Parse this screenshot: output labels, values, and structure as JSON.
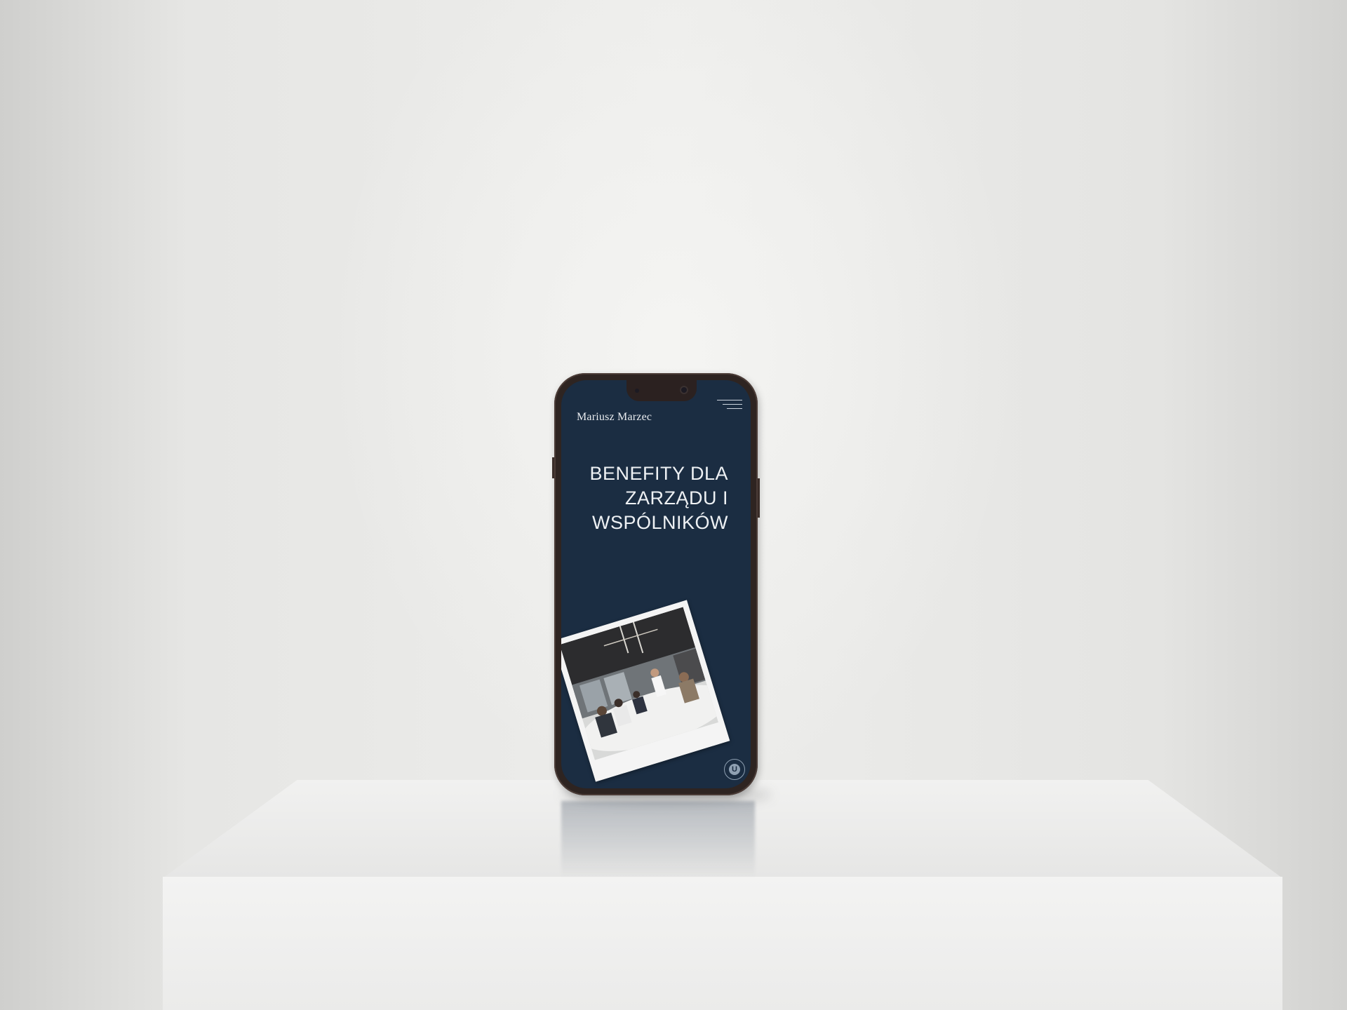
{
  "site": {
    "brand_name": "Mariusz Marzec",
    "menu_icon": "hamburger-menu-icon",
    "hero": {
      "title_lines": [
        "BENEFITY DLA",
        "ZARZĄDU I",
        "WSPÓLNIKÓW"
      ]
    },
    "scroll_button": {
      "icon": "scroll-down-icon",
      "glyph": "U"
    }
  },
  "colors": {
    "screen_background": "#1b2d42",
    "text": "#eef1f4",
    "accent": "#8fa0b2",
    "phone_frame": "#2e2421"
  }
}
